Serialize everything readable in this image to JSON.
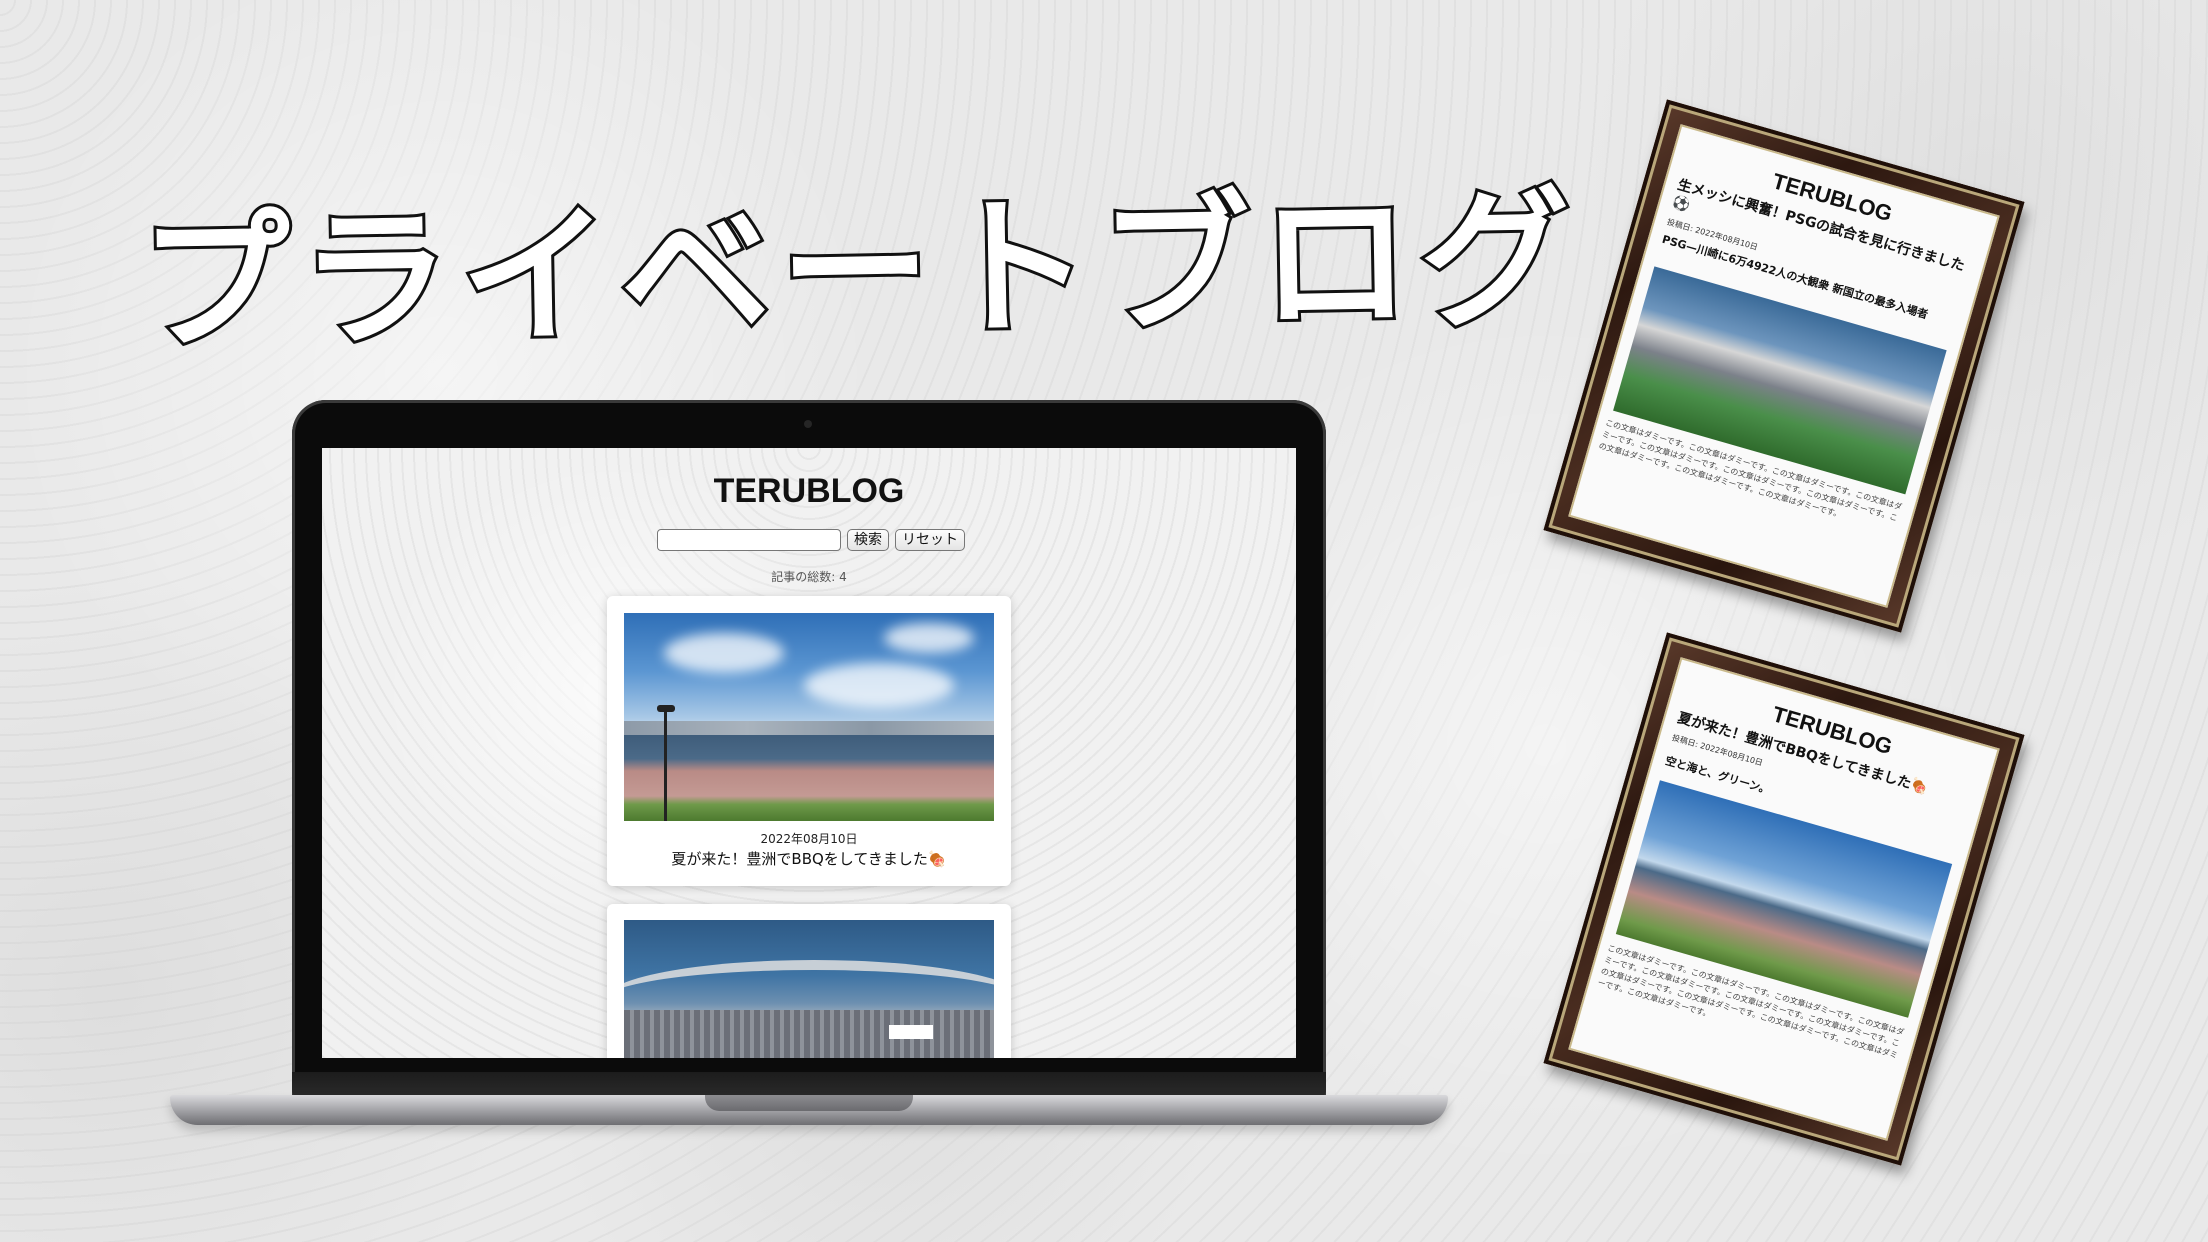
{
  "hero": {
    "title": "プライベートブログ"
  },
  "laptop": {
    "blog": {
      "site_title": "TERUBLOG",
      "search": {
        "value": "",
        "placeholder": "",
        "button_label": "検索",
        "reset_label": "リセット"
      },
      "article_count": "記事の総数: 4",
      "cards": [
        {
          "date": "2022年08月10日",
          "title": "夏が来た！豊洲でBBQをしてきました🍖",
          "image": "bay-photo"
        },
        {
          "date": "",
          "title": "",
          "image": "stadium-photo"
        }
      ]
    }
  },
  "frames": [
    {
      "site_title": "TERUBLOG",
      "heading": "生メッシに興奮！PSGの試合を見に行きました⚽",
      "date": "投稿日: 2022年08月10日",
      "subheading": "PSG—川崎に6万4922人の大観衆 新国立の最多入場者",
      "body": "この文章はダミーです。この文章はダミーです。この文章はダミーです。この文章はダミーです。この文章はダミーです。この文章はダミーです。この文章はダミーです。この文章はダミーです。この文章はダミーです。この文章はダミーです。"
    },
    {
      "site_title": "TERUBLOG",
      "heading": "夏が来た！豊洲でBBQをしてきました🍖",
      "date": "投稿日: 2022年08月10日",
      "subheading": "空と海と、グリーン。",
      "body": "この文章はダミーです。この文章はダミーです。この文章はダミーです。この文章はダミーです。この文章はダミーです。この文章はダミーです。この文章はダミーです。この文章はダミーです。この文章はダミーです。この文章はダミーです。この文章はダミーです。この文章はダミーです。"
    }
  ],
  "colors": {
    "background": "#e9e9e9",
    "laptop_bezel": "#0b0b0b",
    "frame_wood": "#3a2216",
    "frame_gold": "#b9a77a"
  }
}
